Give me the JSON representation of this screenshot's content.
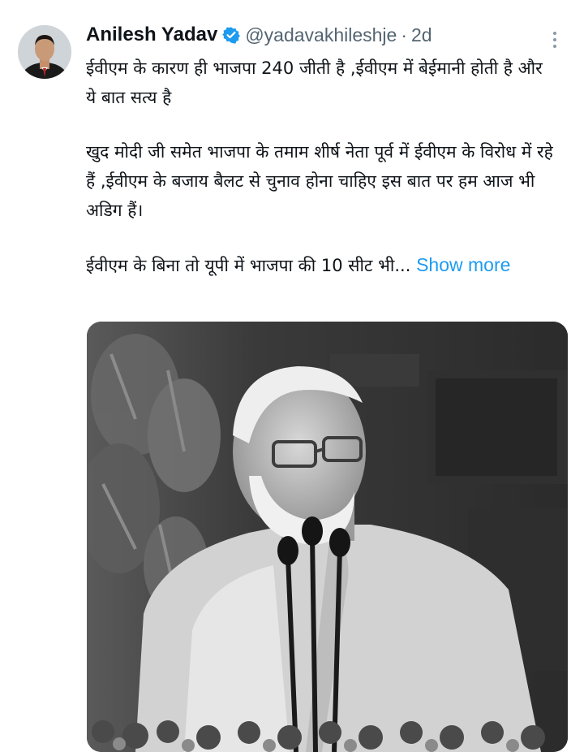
{
  "tweet": {
    "author": {
      "display_name": "Anilesh Yadav",
      "handle": "@yadavakhileshje",
      "verified": true,
      "verified_color": "#1d9bf0"
    },
    "separator": "·",
    "time": "2d",
    "text": {
      "paragraphs": [
        "ईवीएम के कारण ही भाजपा 240 जीती है ,ईवीएम में बेईमानी होती है और ये बात सत्य है",
        "खुद मोदी जी समेत भाजपा के तमाम शीर्ष नेता पूर्व में ईवीएम के विरोध में रहे हैं ,ईवीएम के बजाय बैलट से चुनाव होना चाहिए इस बात पर हम आज भी अडिग हैं।",
        "ईवीएम के बिना तो यूपी में भाजपा की 10 सीट भी..."
      ],
      "show_more": "Show more"
    },
    "icons": {
      "avatar": "profile-photo",
      "verified": "verified-badge-icon",
      "more": "more-options-icon"
    },
    "colors": {
      "link": "#1d9bf0",
      "secondary_text": "#536471",
      "primary_text": "#0f1419"
    },
    "media": {
      "kind": "video-still",
      "tone": "black-and-white",
      "description_icon": "speaker-at-podium-photo"
    }
  }
}
